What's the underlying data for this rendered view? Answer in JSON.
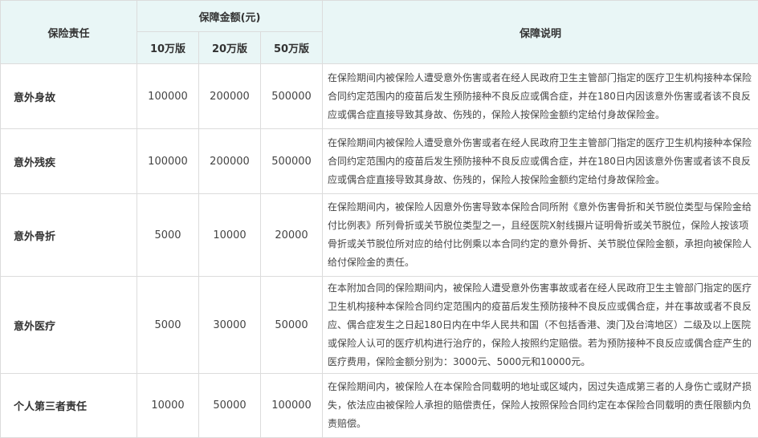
{
  "header": {
    "category": "保险责任",
    "amount_group": "保障金额(元)",
    "plans": [
      "10万版",
      "20万版",
      "50万版"
    ],
    "description": "保障说明"
  },
  "rows": [
    {
      "name": "意外身故",
      "amounts": [
        "100000",
        "200000",
        "500000"
      ],
      "description": "在保险期间内被保险人遭受意外伤害或者在经人民政府卫生主管部门指定的医疗卫生机构接种本保险合同约定范围内的疫苗后发生预防接种不良反应或偶合症，并在180日内因该意外伤害或者该不良反应或偶合症直接导致其身故、伤残的，保险人按保险金额约定给付身故保险金。"
    },
    {
      "name": "意外残疾",
      "amounts": [
        "100000",
        "200000",
        "500000"
      ],
      "description": "在保险期间内被保险人遭受意外伤害或者在经人民政府卫生主管部门指定的医疗卫生机构接种本保险合同约定范围内的疫苗后发生预防接种不良反应或偶合症，并在180日内因该意外伤害或者该不良反应或偶合症直接导致其身故、伤残的，保险人按保险金额约定给付身故保险金。"
    },
    {
      "name": "意外骨折",
      "amounts": [
        "5000",
        "10000",
        "20000"
      ],
      "description": "在保险期间内，被保险人因意外伤害导致本保险合同所附《意外伤害骨折和关节脱位类型与保险金给付比例表》所列骨折或关节脱位类型之一，且经医院X射线摄片证明骨折或关节脱位，保险人按该项骨折或关节脱位所对应的给付比例乘以本合同约定的意外骨折、关节脱位保险金额，承担向被保险人给付保险金的责任。"
    },
    {
      "name": "意外医疗",
      "amounts": [
        "5000",
        "30000",
        "50000"
      ],
      "description": "在本附加合同的保险期间内，被保险人遭受意外伤害事故或者在经人民政府卫生主管部门指定的医疗卫生机构接种本保险合同约定范围内的疫苗后发生预防接种不良反应或偶合症，并在事故或者不良反应、偶合症发生之日起180日内在中华人民共和国（不包括香港、澳门及台湾地区）二级及以上医院或保险人认可的医疗机构进行治疗的，保险人按照约定赔偿。若为预防接种不良反应或偶合症产生的医疗费用，保险金额分别为：3000元、5000元和10000元。"
    },
    {
      "name": "个人第三者责任",
      "amounts": [
        "10000",
        "50000",
        "100000"
      ],
      "description": "在保险期间内，被保险人在本保险合同载明的地址或区域内，因过失造成第三者的人身伤亡或财产损失，依法应由被保险人承担的赔偿责任，保险人按照保险合同约定在本保险合同载明的责任限额内负责赔偿。"
    }
  ]
}
